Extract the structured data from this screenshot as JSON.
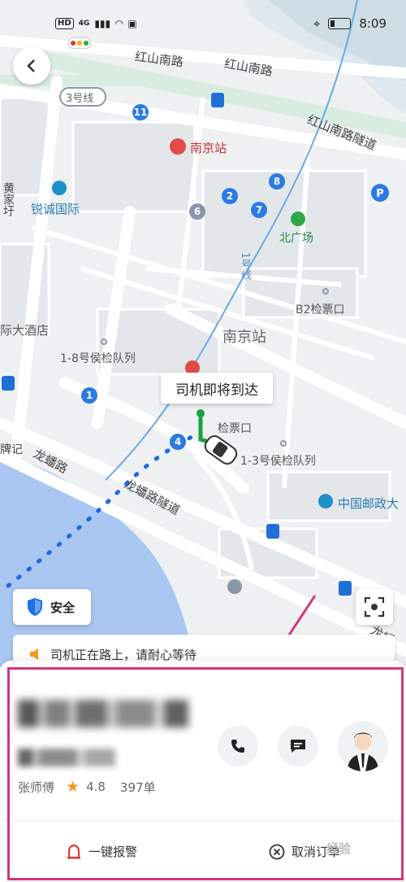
{
  "status_bar": {
    "network": "4G",
    "hd": "HD",
    "time": "8:09"
  },
  "map": {
    "labels": {
      "hongshan_road_1": "红山南路",
      "hongshan_road_2": "红山南路",
      "hongshan_tunnel": "红山南路隧道",
      "line3": "3号线",
      "nanjing_station_top": "南京站",
      "ruicheng": "锐诚国际",
      "huangjia": "黄家圩",
      "north_square": "北广场",
      "line1": "1号线",
      "b2_gate": "B2检票口",
      "nanjing_station_center": "南京站",
      "hotel": "际大酒店",
      "queue_1_8": "1-8号侯检队列",
      "gate": "检票口",
      "queue_1_3": "1-3号侯检队列",
      "longpan_road": "龙蟠路",
      "longpan_tunnel": "龙蟠路隧道",
      "china_post": "中国邮政大",
      "longpan_right": "龙蟠",
      "ji": "牌记"
    },
    "markers": [
      "11",
      "8",
      "2",
      "7",
      "6",
      "1",
      "4"
    ],
    "colors": {
      "water": "#a9c7f2",
      "road": "#ffffff",
      "block": "#e4e7ea",
      "green": "#d9ece0",
      "route_blue": "#1f6ae6",
      "route_green": "#1aa33b"
    }
  },
  "bubble": {
    "text": "司机即将到达"
  },
  "safety_button": {
    "label": "安全"
  },
  "notice": {
    "text": "司机正在路上，请耐心等待"
  },
  "driver": {
    "name": "张师傅",
    "rating": "4.8",
    "orders": "397单"
  },
  "actions": {
    "alarm": "一键报警",
    "cancel": "取消订单"
  },
  "watermark": "经验",
  "colors": {
    "accent": "#d3357f",
    "alarm_red": "#e03a3a",
    "star": "#f39b1a",
    "safe_blue": "#1a73e8"
  }
}
